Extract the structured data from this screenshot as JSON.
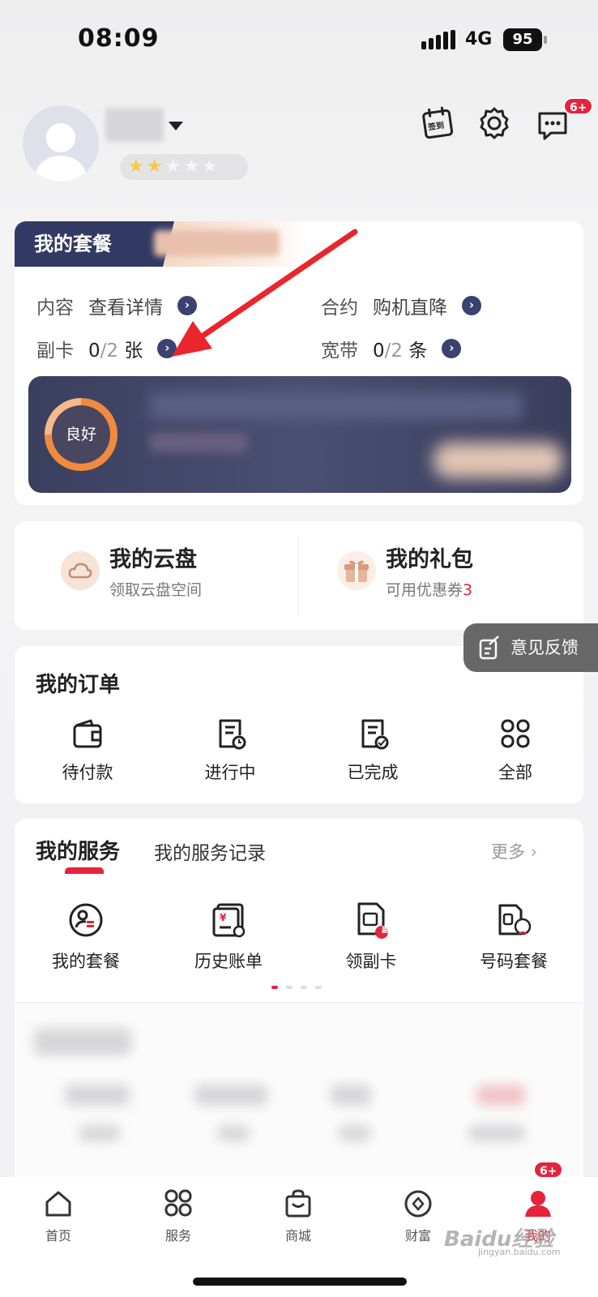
{
  "status_bar": {
    "time": "08:09",
    "network": "4G",
    "battery": "95"
  },
  "header": {
    "message_badge": "6+",
    "checkin_label": "签到"
  },
  "plan": {
    "tab_title": "我的套餐",
    "rows": [
      {
        "label": "内容",
        "value": "查看详情"
      },
      {
        "label": "合约",
        "value": "购机直降"
      },
      {
        "label": "副卡",
        "count": "0",
        "total": "/2",
        "unit": "张"
      },
      {
        "label": "宽带",
        "count": "0",
        "total": "/2",
        "unit": "条"
      }
    ],
    "status_ring": "良好"
  },
  "quick": {
    "cloud": {
      "title": "我的云盘",
      "sub": "领取云盘空间"
    },
    "gift": {
      "title": "我的礼包",
      "sub": "可用优惠券",
      "count": "3"
    }
  },
  "feedback_label": "意见反馈",
  "orders": {
    "title": "我的订单",
    "items": [
      "待付款",
      "进行中",
      "已完成",
      "全部"
    ]
  },
  "services": {
    "tab_active": "我的服务",
    "tab_other": "我的服务记录",
    "more": "更多",
    "items": [
      "我的套餐",
      "历史账单",
      "领副卡",
      "号码套餐"
    ],
    "icon_badge_vice": "副"
  },
  "nav": {
    "items": [
      "首页",
      "服务",
      "商城",
      "财富",
      "我的"
    ],
    "me_badge": "6+"
  },
  "watermark": {
    "brand": "Baidu经验",
    "url": "jingyan.baidu.com"
  },
  "colors": {
    "accent": "#e5233b",
    "plan_dark": "#323a64",
    "star": "#f7c843"
  }
}
